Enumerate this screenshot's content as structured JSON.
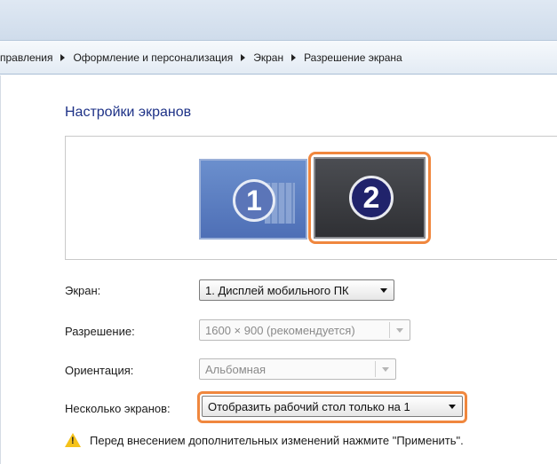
{
  "breadcrumb": {
    "items": [
      "правления",
      "Оформление и персонализация",
      "Экран",
      "Разрешение экрана"
    ]
  },
  "page_title": "Настройки экранов",
  "monitors": [
    {
      "number": "1"
    },
    {
      "number": "2"
    }
  ],
  "form": {
    "screen_label": "Экран:",
    "screen_value": "1. Дисплей мобильного ПК",
    "resolution_label": "Разрешение:",
    "resolution_value": "1600 × 900 (рекомендуется)",
    "orientation_label": "Ориентация:",
    "orientation_value": "Альбомная",
    "multi_label": "Несколько экранов:",
    "multi_value": "Отобразить рабочий стол только на 1"
  },
  "warning": {
    "icon": "warning-icon",
    "text": "Перед внесением дополнительных изменений нажмите \"Применить\"."
  },
  "colors": {
    "title": "#1e3287",
    "highlight": "#f0873e"
  }
}
